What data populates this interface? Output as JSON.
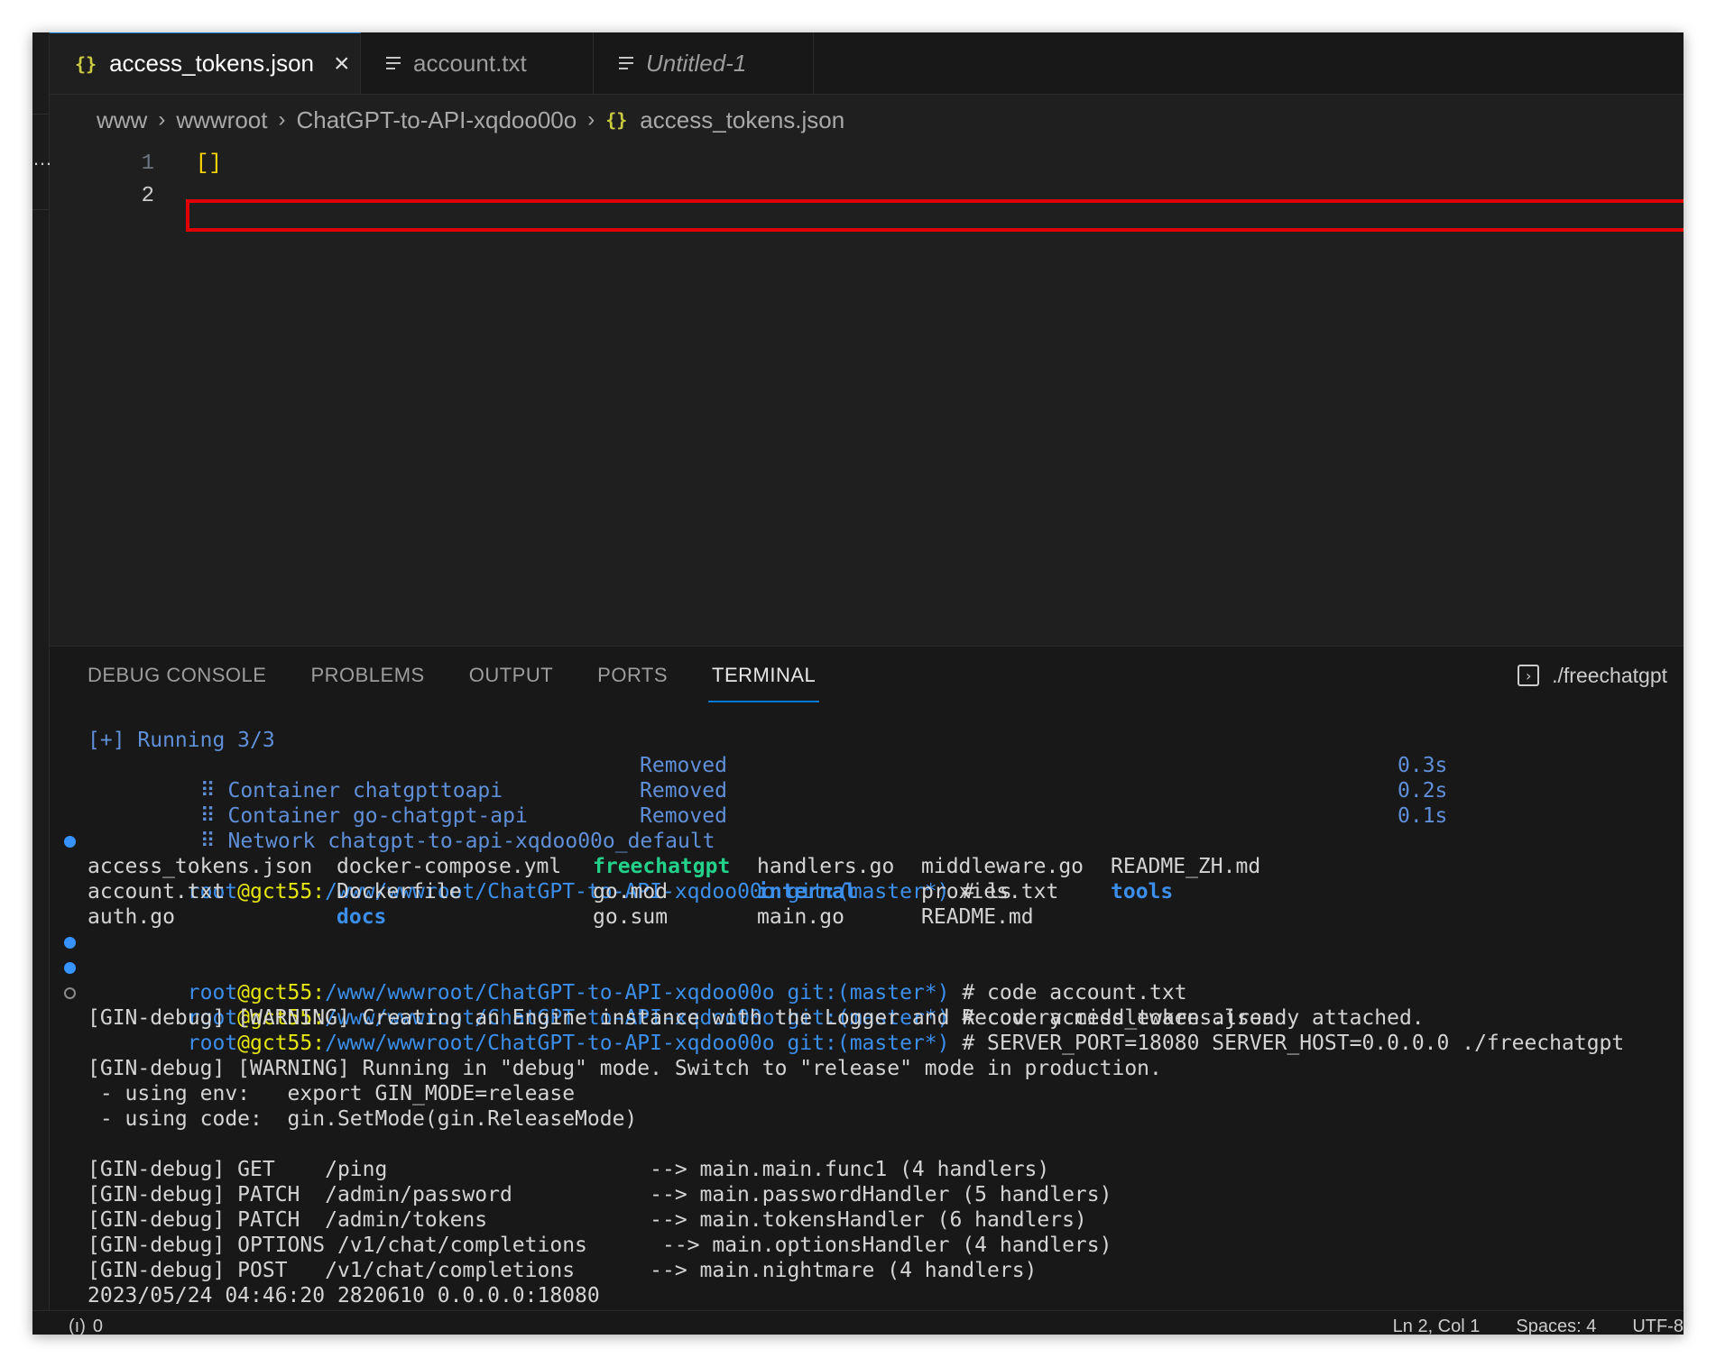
{
  "tabs": [
    {
      "icon": "{}",
      "label": "access_tokens.json",
      "active": true
    },
    {
      "icon": "txt",
      "label": "account.txt",
      "active": false
    },
    {
      "icon": "txt",
      "label": "Untitled-1",
      "active": false
    }
  ],
  "breadcrumb": [
    "www",
    "wwwroot",
    "ChatGPT-to-API-xqdoo00o",
    "access_tokens.json"
  ],
  "editor": {
    "lines": [
      {
        "number": "1",
        "text": "[]"
      },
      {
        "number": "2",
        "text": ""
      }
    ]
  },
  "panel": {
    "tabs": [
      "DEBUG CONSOLE",
      "PROBLEMS",
      "OUTPUT",
      "PORTS",
      "TERMINAL"
    ],
    "active_tab": "TERMINAL",
    "terminal_name": "./freechatgpt"
  },
  "terminal": {
    "running": "[+] Running 3/3",
    "steps": [
      {
        "label": "⠿ Container chatgpttoapi",
        "status": "Removed",
        "time": "0.3s"
      },
      {
        "label": "⠿ Container go-chatgpt-api",
        "status": "Removed",
        "time": "0.2s"
      },
      {
        "label": "⠿ Network chatgpt-to-api-xqdoo00o_default",
        "status": "Removed",
        "time": "0.1s"
      }
    ],
    "prompt": {
      "user": "root",
      "host": "@gct55:",
      "path": "/www/wwwroot/ChatGPT-to-API-xqdoo00o",
      "git": " git:(master*)",
      "hash": " # "
    },
    "commands": [
      "ls",
      "code account.txt",
      "code access_tokens.json",
      "SERVER_PORT=18080 SERVER_HOST=0.0.0.0 ./freechatgpt"
    ],
    "ls_rows": [
      [
        "access_tokens.json",
        "docker-compose.yml",
        "freechatgpt",
        "handlers.go",
        "middleware.go",
        "README_ZH.md"
      ],
      [
        "account.txt",
        "Dockerfile",
        "go.mod",
        "internal",
        "proxies.txt",
        "tools"
      ],
      [
        "auth.go",
        "docs",
        "go.sum",
        "main.go",
        "README.md",
        ""
      ]
    ],
    "output": [
      "[GIN-debug] [WARNING] Creating an Engine instance with the Logger and Recovery middleware already attached.",
      "",
      "[GIN-debug] [WARNING] Running in \"debug\" mode. Switch to \"release\" mode in production.",
      " - using env:   export GIN_MODE=release",
      " - using code:  gin.SetMode(gin.ReleaseMode)",
      "",
      "[GIN-debug] GET    /ping                     --> main.main.func1 (4 handlers)",
      "[GIN-debug] PATCH  /admin/password           --> main.passwordHandler (5 handlers)",
      "[GIN-debug] PATCH  /admin/tokens             --> main.tokensHandler (6 handlers)",
      "[GIN-debug] OPTIONS /v1/chat/completions      --> main.optionsHandler (4 handlers)",
      "[GIN-debug] POST   /v1/chat/completions      --> main.nightmare (4 handlers)",
      "2023/05/24 04:46:20 2820610 0.0.0.0:18080"
    ]
  },
  "statusbar": {
    "ports": "0",
    "position": "Ln 2, Col 1",
    "spaces": "Spaces: 4",
    "encoding": "UTF-8"
  }
}
